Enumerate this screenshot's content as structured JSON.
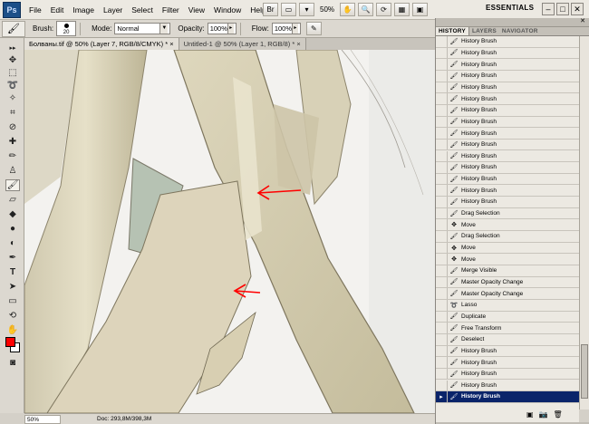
{
  "app": {
    "logo": "Ps",
    "menu": [
      "File",
      "Edit",
      "Image",
      "Layer",
      "Select",
      "Filter",
      "View",
      "Window",
      "Help"
    ],
    "zoom_level": "50%",
    "workspace": "ESSENTIALS",
    "win_minimize": "–",
    "win_maximize": "□",
    "win_close": "✕"
  },
  "options": {
    "brush_label": "Brush:",
    "brush_size": "20",
    "mode_label": "Mode:",
    "mode_value": "Normal",
    "opacity_label": "Opacity:",
    "opacity_value": "100%",
    "flow_label": "Flow:",
    "flow_value": "100%"
  },
  "tabs": [
    {
      "label": "Болваны.tif @ 50% (Layer 7, RGB/8/CMYK) *"
    },
    {
      "label": "Untitled-1 @ 50% (Layer 1, RGB/8) *"
    }
  ],
  "status": {
    "zoom": "50%",
    "doc": "Doc: 293,8M/398,3M"
  },
  "panel": {
    "tabs": [
      "HISTORY",
      "LAYERS",
      "NAVIGATOR"
    ],
    "history": [
      {
        "label": "History Brush",
        "icon": "history-brush-icon"
      },
      {
        "label": "History Brush",
        "icon": "history-brush-icon"
      },
      {
        "label": "History Brush",
        "icon": "history-brush-icon"
      },
      {
        "label": "History Brush",
        "icon": "history-brush-icon"
      },
      {
        "label": "History Brush",
        "icon": "history-brush-icon"
      },
      {
        "label": "History Brush",
        "icon": "history-brush-icon"
      },
      {
        "label": "History Brush",
        "icon": "history-brush-icon"
      },
      {
        "label": "History Brush",
        "icon": "history-brush-icon"
      },
      {
        "label": "History Brush",
        "icon": "history-brush-icon"
      },
      {
        "label": "History Brush",
        "icon": "history-brush-icon"
      },
      {
        "label": "History Brush",
        "icon": "history-brush-icon"
      },
      {
        "label": "History Brush",
        "icon": "history-brush-icon"
      },
      {
        "label": "History Brush",
        "icon": "history-brush-icon"
      },
      {
        "label": "History Brush",
        "icon": "history-brush-icon"
      },
      {
        "label": "History Brush",
        "icon": "history-brush-icon"
      },
      {
        "label": "Drag Selection",
        "icon": "history-brush-icon"
      },
      {
        "label": "Move",
        "icon": "move-icon"
      },
      {
        "label": "Drag Selection",
        "icon": "history-brush-icon"
      },
      {
        "label": "Move",
        "icon": "move-icon"
      },
      {
        "label": "Move",
        "icon": "move-icon"
      },
      {
        "label": "Merge Visible",
        "icon": "history-brush-icon"
      },
      {
        "label": "Master Opacity Change",
        "icon": "history-brush-icon"
      },
      {
        "label": "Master Opacity Change",
        "icon": "history-brush-icon"
      },
      {
        "label": "Lasso",
        "icon": "lasso-icon"
      },
      {
        "label": "Duplicate",
        "icon": "history-brush-icon"
      },
      {
        "label": "Free Transform",
        "icon": "history-brush-icon"
      },
      {
        "label": "Deselect",
        "icon": "history-brush-icon"
      },
      {
        "label": "History Brush",
        "icon": "history-brush-icon"
      },
      {
        "label": "History Brush",
        "icon": "history-brush-icon"
      },
      {
        "label": "History Brush",
        "icon": "history-brush-icon"
      },
      {
        "label": "History Brush",
        "icon": "history-brush-icon"
      },
      {
        "label": "History Brush",
        "icon": "history-brush-icon",
        "selected": true
      }
    ]
  },
  "colors": {
    "foreground": "#ff0000",
    "background": "#ffffff",
    "annotation": "#ff0000",
    "selection": "#0a246a"
  }
}
